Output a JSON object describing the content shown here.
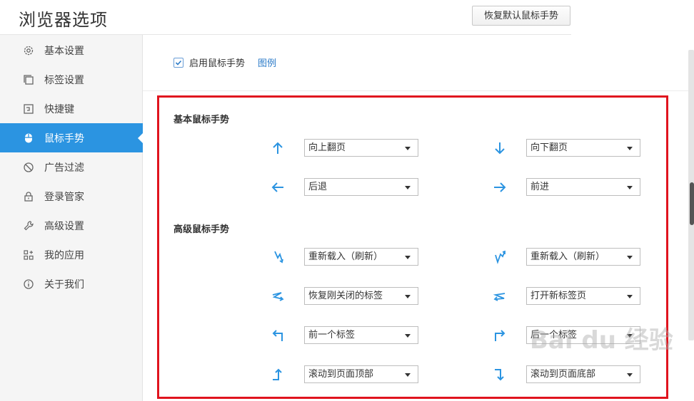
{
  "header": {
    "title": "浏览器选项",
    "restore_button": "恢复默认鼠标手势"
  },
  "sidebar": {
    "items": [
      {
        "label": "基本设置",
        "icon": "gear-icon"
      },
      {
        "label": "标签设置",
        "icon": "tabs-icon"
      },
      {
        "label": "快捷键",
        "icon": "keyboard-icon"
      },
      {
        "label": "鼠标手势",
        "icon": "mouse-icon",
        "active": true
      },
      {
        "label": "广告过滤",
        "icon": "block-icon"
      },
      {
        "label": "登录管家",
        "icon": "lock-icon"
      },
      {
        "label": "高级设置",
        "icon": "wrench-icon"
      },
      {
        "label": "我的应用",
        "icon": "apps-icon"
      },
      {
        "label": "关于我们",
        "icon": "info-icon"
      }
    ]
  },
  "main": {
    "enable_label": "启用鼠标手势",
    "enable_checked": true,
    "legend_link": "图例",
    "basic_title": "基本鼠标手势",
    "advanced_title": "高级鼠标手势",
    "basic": [
      {
        "gesture": "up-arrow-icon",
        "action": "向上翻页"
      },
      {
        "gesture": "down-arrow-icon",
        "action": "向下翻页"
      },
      {
        "gesture": "left-arrow-icon",
        "action": "后退"
      },
      {
        "gesture": "right-arrow-icon",
        "action": "前进"
      }
    ],
    "advanced": [
      {
        "gesture": "down-up-down-icon",
        "action": "重新载入（刷新）"
      },
      {
        "gesture": "up-down-up-icon",
        "action": "重新载入（刷新）"
      },
      {
        "gesture": "right-left-right-icon",
        "action": "恢复刚关闭的标签"
      },
      {
        "gesture": "left-right-left-icon",
        "action": "打开新标签页"
      },
      {
        "gesture": "up-left-icon",
        "action": "前一个标签"
      },
      {
        "gesture": "up-right-icon",
        "action": "后一个标签"
      },
      {
        "gesture": "right-up-icon",
        "action": "滚动到页面顶部"
      },
      {
        "gesture": "right-down-icon",
        "action": "滚动到页面底部"
      }
    ]
  },
  "colors": {
    "accent": "#2b94e1",
    "highlight_border": "#e0141e",
    "arrow": "#2b94e1"
  },
  "watermark": "Bai du 经验"
}
